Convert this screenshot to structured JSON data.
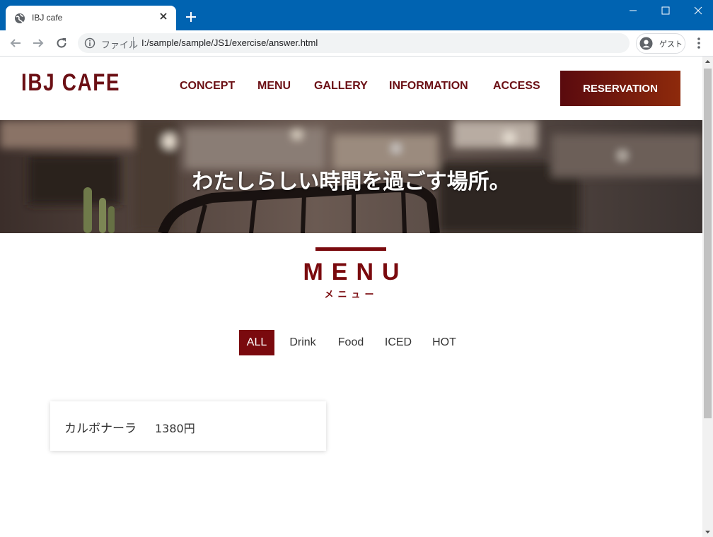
{
  "browser": {
    "tab_title": "IBJ cafe",
    "address": {
      "scheme_label": "ファイル",
      "url": "I:/sample/sample/JS1/exercise/answer.html"
    },
    "profile_label": "ゲスト"
  },
  "site": {
    "logo": "IBJ CAFE",
    "nav": [
      "CONCEPT",
      "MENU",
      "GALLERY",
      "INFORMATION",
      "ACCESS"
    ],
    "reservation": "RESERVATION",
    "hero_text": "わたしらしい時間を過ごす場所。",
    "section_title": "MENU",
    "section_subtitle": "メニュー",
    "filters": [
      "ALL",
      "Drink",
      "Food",
      "ICED",
      "HOT"
    ],
    "active_filter": "ALL",
    "items": [
      {
        "name": "カルボナーラ",
        "price": "1380円"
      }
    ]
  },
  "colors": {
    "accent": "#7a0a0e",
    "chrome_blue": "#0063b1"
  }
}
